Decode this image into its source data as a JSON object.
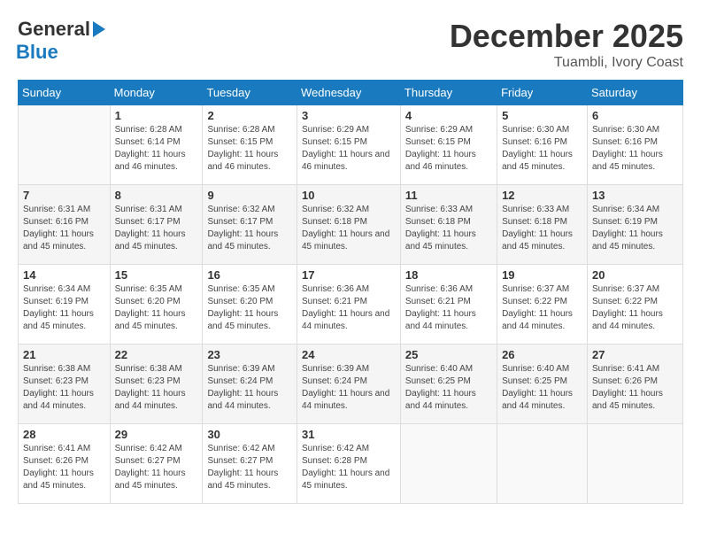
{
  "header": {
    "logo_general": "General",
    "logo_blue": "Blue",
    "month": "December 2025",
    "location": "Tuambli, Ivory Coast"
  },
  "calendar": {
    "days_of_week": [
      "Sunday",
      "Monday",
      "Tuesday",
      "Wednesday",
      "Thursday",
      "Friday",
      "Saturday"
    ],
    "weeks": [
      [
        {
          "day": "",
          "sunrise": "",
          "sunset": "",
          "daylight": ""
        },
        {
          "day": "1",
          "sunrise": "Sunrise: 6:28 AM",
          "sunset": "Sunset: 6:14 PM",
          "daylight": "Daylight: 11 hours and 46 minutes."
        },
        {
          "day": "2",
          "sunrise": "Sunrise: 6:28 AM",
          "sunset": "Sunset: 6:15 PM",
          "daylight": "Daylight: 11 hours and 46 minutes."
        },
        {
          "day": "3",
          "sunrise": "Sunrise: 6:29 AM",
          "sunset": "Sunset: 6:15 PM",
          "daylight": "Daylight: 11 hours and 46 minutes."
        },
        {
          "day": "4",
          "sunrise": "Sunrise: 6:29 AM",
          "sunset": "Sunset: 6:15 PM",
          "daylight": "Daylight: 11 hours and 46 minutes."
        },
        {
          "day": "5",
          "sunrise": "Sunrise: 6:30 AM",
          "sunset": "Sunset: 6:16 PM",
          "daylight": "Daylight: 11 hours and 45 minutes."
        },
        {
          "day": "6",
          "sunrise": "Sunrise: 6:30 AM",
          "sunset": "Sunset: 6:16 PM",
          "daylight": "Daylight: 11 hours and 45 minutes."
        }
      ],
      [
        {
          "day": "7",
          "sunrise": "Sunrise: 6:31 AM",
          "sunset": "Sunset: 6:16 PM",
          "daylight": "Daylight: 11 hours and 45 minutes."
        },
        {
          "day": "8",
          "sunrise": "Sunrise: 6:31 AM",
          "sunset": "Sunset: 6:17 PM",
          "daylight": "Daylight: 11 hours and 45 minutes."
        },
        {
          "day": "9",
          "sunrise": "Sunrise: 6:32 AM",
          "sunset": "Sunset: 6:17 PM",
          "daylight": "Daylight: 11 hours and 45 minutes."
        },
        {
          "day": "10",
          "sunrise": "Sunrise: 6:32 AM",
          "sunset": "Sunset: 6:18 PM",
          "daylight": "Daylight: 11 hours and 45 minutes."
        },
        {
          "day": "11",
          "sunrise": "Sunrise: 6:33 AM",
          "sunset": "Sunset: 6:18 PM",
          "daylight": "Daylight: 11 hours and 45 minutes."
        },
        {
          "day": "12",
          "sunrise": "Sunrise: 6:33 AM",
          "sunset": "Sunset: 6:18 PM",
          "daylight": "Daylight: 11 hours and 45 minutes."
        },
        {
          "day": "13",
          "sunrise": "Sunrise: 6:34 AM",
          "sunset": "Sunset: 6:19 PM",
          "daylight": "Daylight: 11 hours and 45 minutes."
        }
      ],
      [
        {
          "day": "14",
          "sunrise": "Sunrise: 6:34 AM",
          "sunset": "Sunset: 6:19 PM",
          "daylight": "Daylight: 11 hours and 45 minutes."
        },
        {
          "day": "15",
          "sunrise": "Sunrise: 6:35 AM",
          "sunset": "Sunset: 6:20 PM",
          "daylight": "Daylight: 11 hours and 45 minutes."
        },
        {
          "day": "16",
          "sunrise": "Sunrise: 6:35 AM",
          "sunset": "Sunset: 6:20 PM",
          "daylight": "Daylight: 11 hours and 45 minutes."
        },
        {
          "day": "17",
          "sunrise": "Sunrise: 6:36 AM",
          "sunset": "Sunset: 6:21 PM",
          "daylight": "Daylight: 11 hours and 44 minutes."
        },
        {
          "day": "18",
          "sunrise": "Sunrise: 6:36 AM",
          "sunset": "Sunset: 6:21 PM",
          "daylight": "Daylight: 11 hours and 44 minutes."
        },
        {
          "day": "19",
          "sunrise": "Sunrise: 6:37 AM",
          "sunset": "Sunset: 6:22 PM",
          "daylight": "Daylight: 11 hours and 44 minutes."
        },
        {
          "day": "20",
          "sunrise": "Sunrise: 6:37 AM",
          "sunset": "Sunset: 6:22 PM",
          "daylight": "Daylight: 11 hours and 44 minutes."
        }
      ],
      [
        {
          "day": "21",
          "sunrise": "Sunrise: 6:38 AM",
          "sunset": "Sunset: 6:23 PM",
          "daylight": "Daylight: 11 hours and 44 minutes."
        },
        {
          "day": "22",
          "sunrise": "Sunrise: 6:38 AM",
          "sunset": "Sunset: 6:23 PM",
          "daylight": "Daylight: 11 hours and 44 minutes."
        },
        {
          "day": "23",
          "sunrise": "Sunrise: 6:39 AM",
          "sunset": "Sunset: 6:24 PM",
          "daylight": "Daylight: 11 hours and 44 minutes."
        },
        {
          "day": "24",
          "sunrise": "Sunrise: 6:39 AM",
          "sunset": "Sunset: 6:24 PM",
          "daylight": "Daylight: 11 hours and 44 minutes."
        },
        {
          "day": "25",
          "sunrise": "Sunrise: 6:40 AM",
          "sunset": "Sunset: 6:25 PM",
          "daylight": "Daylight: 11 hours and 44 minutes."
        },
        {
          "day": "26",
          "sunrise": "Sunrise: 6:40 AM",
          "sunset": "Sunset: 6:25 PM",
          "daylight": "Daylight: 11 hours and 44 minutes."
        },
        {
          "day": "27",
          "sunrise": "Sunrise: 6:41 AM",
          "sunset": "Sunset: 6:26 PM",
          "daylight": "Daylight: 11 hours and 45 minutes."
        }
      ],
      [
        {
          "day": "28",
          "sunrise": "Sunrise: 6:41 AM",
          "sunset": "Sunset: 6:26 PM",
          "daylight": "Daylight: 11 hours and 45 minutes."
        },
        {
          "day": "29",
          "sunrise": "Sunrise: 6:42 AM",
          "sunset": "Sunset: 6:27 PM",
          "daylight": "Daylight: 11 hours and 45 minutes."
        },
        {
          "day": "30",
          "sunrise": "Sunrise: 6:42 AM",
          "sunset": "Sunset: 6:27 PM",
          "daylight": "Daylight: 11 hours and 45 minutes."
        },
        {
          "day": "31",
          "sunrise": "Sunrise: 6:42 AM",
          "sunset": "Sunset: 6:28 PM",
          "daylight": "Daylight: 11 hours and 45 minutes."
        },
        {
          "day": "",
          "sunrise": "",
          "sunset": "",
          "daylight": ""
        },
        {
          "day": "",
          "sunrise": "",
          "sunset": "",
          "daylight": ""
        },
        {
          "day": "",
          "sunrise": "",
          "sunset": "",
          "daylight": ""
        }
      ]
    ]
  }
}
